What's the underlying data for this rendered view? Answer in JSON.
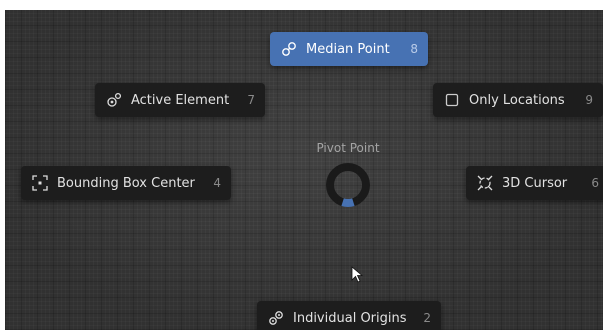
{
  "pie_menu": {
    "title": "Pivot Point",
    "items": {
      "median_point": {
        "label": "Median Point",
        "key": "8",
        "icon": "median-point-icon",
        "selected": true
      },
      "active_element": {
        "label": "Active Element",
        "key": "7",
        "icon": "active-element-icon"
      },
      "only_locations": {
        "label": "Only Locations",
        "key": "9",
        "icon": "checkbox-icon"
      },
      "bounding_box_center": {
        "label": "Bounding Box Center",
        "key": "4",
        "icon": "bounding-box-icon"
      },
      "cursor_3d": {
        "label": "3D Cursor",
        "key": "6",
        "icon": "3d-cursor-icon"
      },
      "individual_origins": {
        "label": "Individual Origins",
        "key": "2",
        "icon": "individual-origins-icon"
      }
    }
  },
  "colors": {
    "viewport_bg": "#393939",
    "button_bg": "#1d1d1d",
    "selected_bg": "#4772b3",
    "dial_ring": "#1a1a1a",
    "dial_indicator": "#4772b3"
  }
}
